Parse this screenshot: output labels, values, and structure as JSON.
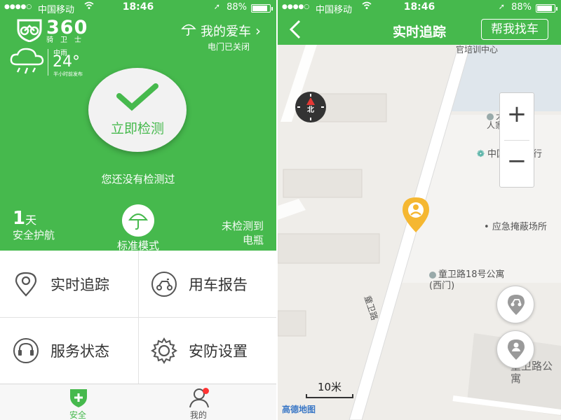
{
  "status_bar": {
    "signal_dots": "●●●●○",
    "carrier": "中国移动",
    "time": "18:46",
    "battery_pct": "88%",
    "battery_level": 0.88
  },
  "home": {
    "brand_text": "360",
    "brand_sub": "骑卫士",
    "my_car_label": "我的爱车",
    "door_status": "电门已关闭",
    "weather": {
      "icon": "rain-cloud-icon",
      "desc": "中雨",
      "temp": "24°",
      "note": "半小时前发布"
    },
    "check_button_label": "立即检测",
    "check_status": "您还没有检测过",
    "stats": {
      "days_value": "1",
      "days_unit": "天",
      "days_label": "安全护航",
      "mode_label": "标准模式",
      "battery_line1": "未检测到",
      "battery_line2": "电瓶"
    },
    "grid": [
      {
        "label": "实时追踪",
        "icon": "location-pin-icon"
      },
      {
        "label": "用车报告",
        "icon": "scooter-icon"
      },
      {
        "label": "服务状态",
        "icon": "headset-icon"
      },
      {
        "label": "安防设置",
        "icon": "gear-icon"
      }
    ],
    "tabs": [
      {
        "label": "安全",
        "icon": "shield-plus-icon",
        "active": true
      },
      {
        "label": "我的",
        "icon": "person-icon",
        "active": false
      }
    ]
  },
  "tracking": {
    "title": "实时追踪",
    "find_button": "帮我找车",
    "compass_label": "北",
    "zoom_in": "+",
    "zoom_out": "−",
    "map_labels": {
      "training_center": "官培训中心",
      "hotel": "大邦云顶人家(西门)",
      "bank": "中国民生银行",
      "shelter": "应急掩蔽场所",
      "apartment_gate": "童卫路18号公寓(西门)",
      "road": "童卫路",
      "apartment": "童卫路公寓"
    },
    "scale_label": "10米",
    "map_provider": "高德地图",
    "colors": {
      "accent": "#46b94d",
      "marker": "#f5b731"
    }
  }
}
